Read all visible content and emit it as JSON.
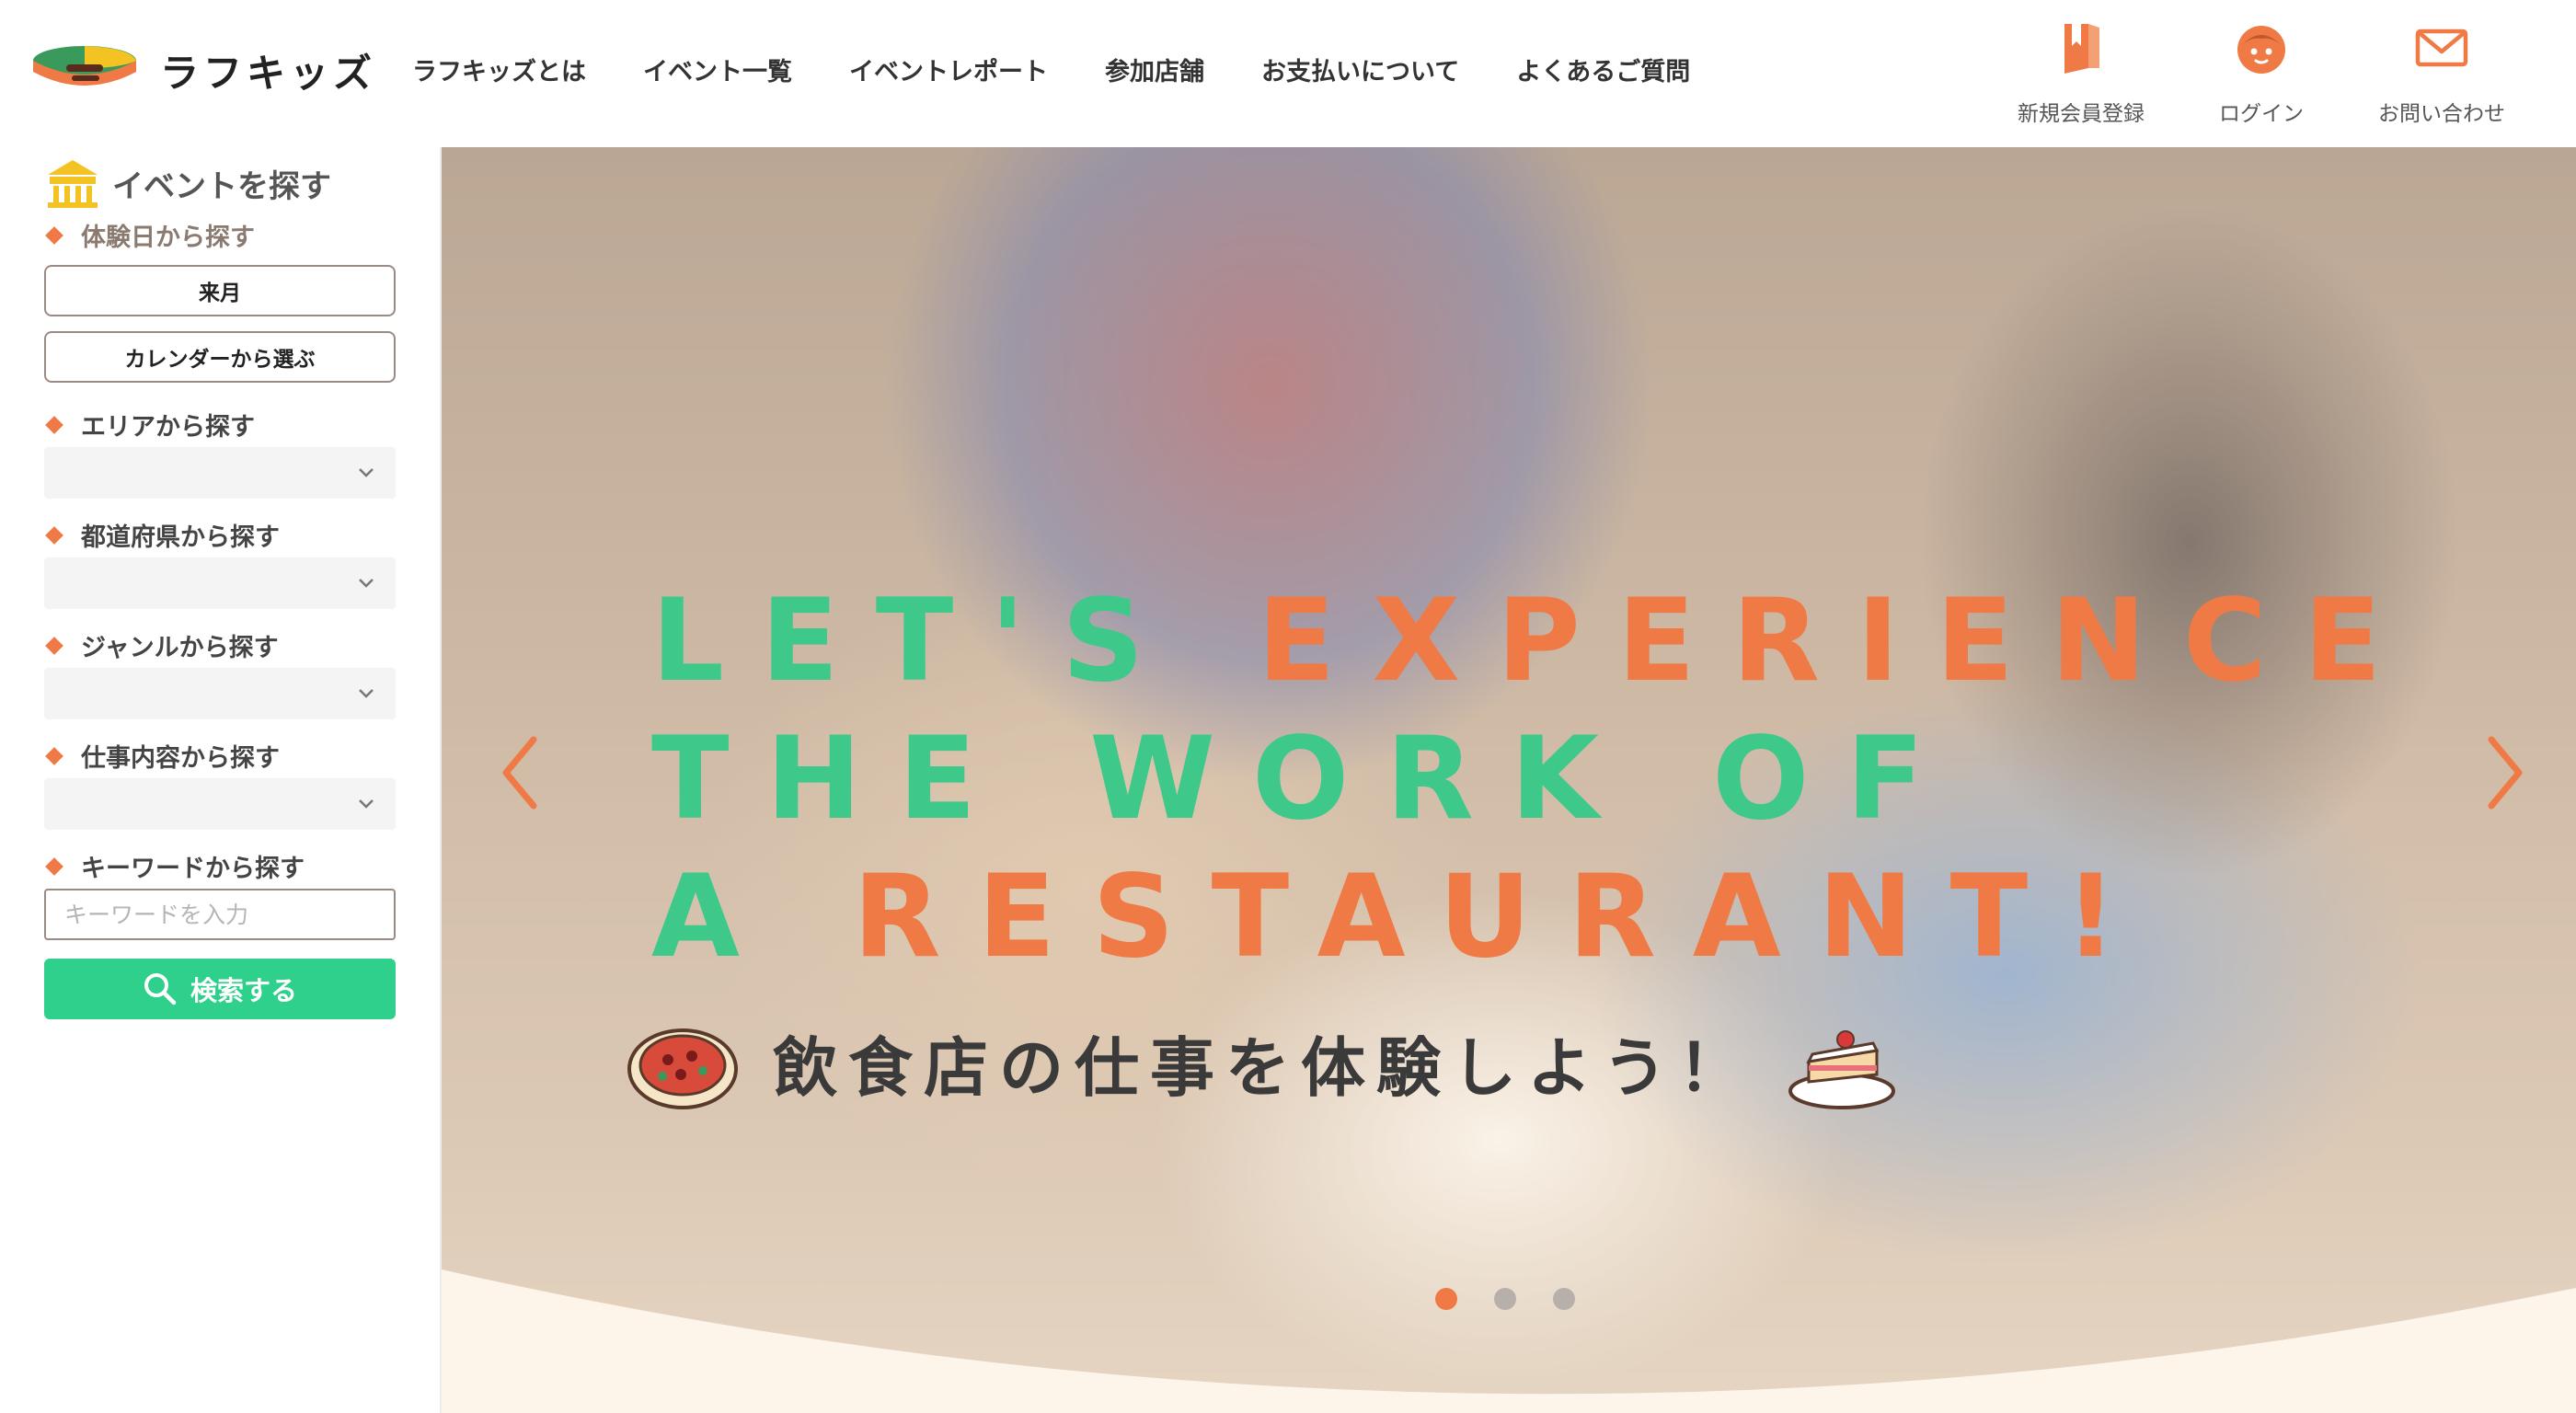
{
  "header": {
    "logo_text": "ラフキッズ",
    "nav": [
      {
        "label": "ラフキッズとは"
      },
      {
        "label": "イベント一覧"
      },
      {
        "label": "イベントレポート"
      },
      {
        "label": "参加店舗"
      },
      {
        "label": "お支払いについて"
      },
      {
        "label": "よくあるご質問"
      }
    ],
    "utility": [
      {
        "label": "新規会員登録",
        "icon": "book-icon"
      },
      {
        "label": "ログイン",
        "icon": "face-icon"
      },
      {
        "label": "お問い合わせ",
        "icon": "mail-icon"
      }
    ]
  },
  "sidebar": {
    "title": "イベントを探す",
    "date_section": {
      "label": "体験日から探す",
      "next_month_button": "来月",
      "calendar_button": "カレンダーから選ぶ"
    },
    "area": {
      "label": "エリアから探す",
      "value": ""
    },
    "prefecture": {
      "label": "都道府県から探す",
      "value": ""
    },
    "genre": {
      "label": "ジャンルから探す",
      "value": ""
    },
    "job": {
      "label": "仕事内容から探す",
      "value": ""
    },
    "keyword": {
      "label": "キーワードから探す",
      "placeholder": "キーワードを入力",
      "value": ""
    },
    "search_button": "検索する"
  },
  "hero": {
    "headline": [
      [
        {
          "text": "LET'S ",
          "color": "green"
        },
        {
          "text": "EXPERIENCE",
          "color": "orange"
        }
      ],
      [
        {
          "text": "THE WORK OF",
          "color": "green"
        }
      ],
      [
        {
          "text": "A ",
          "color": "green"
        },
        {
          "text": "RESTAURANT!",
          "color": "orange"
        }
      ]
    ],
    "subheadline": "飲食店の仕事を体験しよう！",
    "slides": {
      "total": 3,
      "active": 1
    }
  },
  "colors": {
    "accent_orange": "#ef7a45",
    "accent_green": "#3ec98a",
    "search_button": "#2fcf8c"
  }
}
